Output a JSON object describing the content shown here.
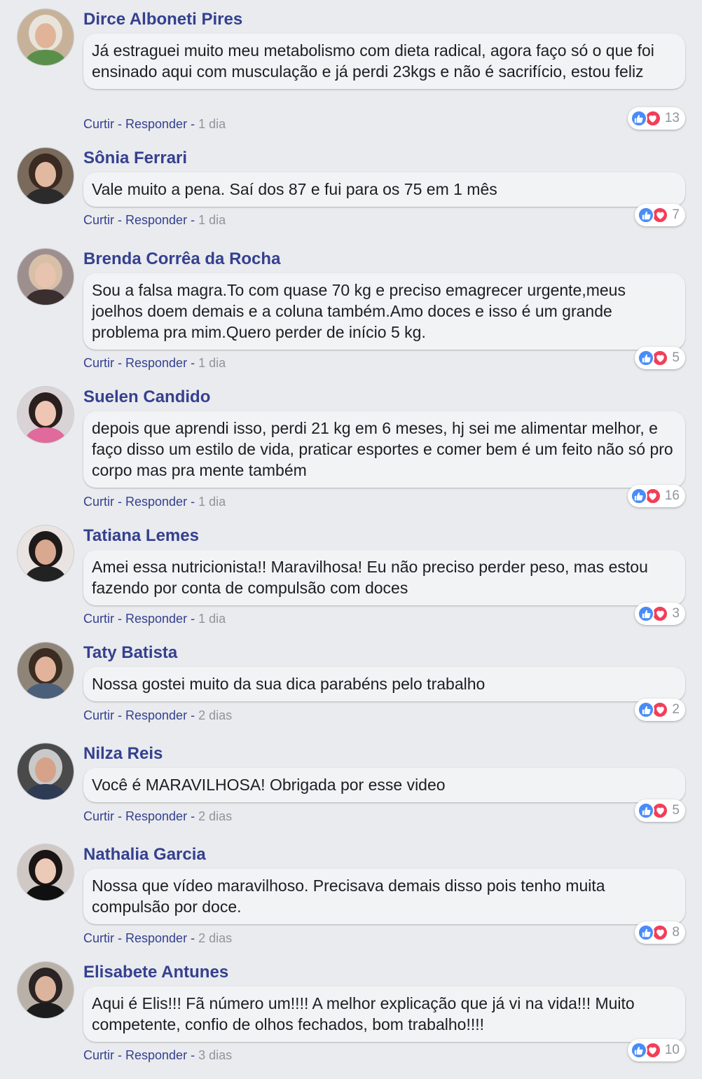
{
  "colors": {
    "background": "#e9ebee",
    "author_name": "#35408f",
    "bubble": "#f2f3f5",
    "timestamp": "#90949c",
    "like": "#4a8cf7",
    "love": "#f33e58"
  },
  "actions": {
    "like_label": "Curtir",
    "separator": " - ",
    "reply_label": "Responder"
  },
  "icons": {
    "like": "thumbs-up-icon",
    "love": "heart-icon"
  },
  "comments": [
    {
      "author": "Dirce Alboneti Pires",
      "text": "Já estraguei muito meu metabolismo com dieta radical, agora faço só o que foi ensinado aqui com musculação e já perdi 23kgs e não é sacrifício, estou feliz",
      "time": "1 dia",
      "reactions": "13"
    },
    {
      "author": "Sônia Ferrari",
      "text": "Vale muito a pena. Saí dos 87 e fui para os 75 em 1 mês",
      "time": "1 dia",
      "reactions": "7"
    },
    {
      "author": "Brenda Corrêa da Rocha",
      "text": "Sou a falsa magra.To com quase 70 kg e preciso emagrecer urgente,meus joelhos doem demais e a coluna também.Amo doces e isso é um grande problema pra mim.Quero perder de início 5 kg.",
      "time": "1 dia",
      "reactions": "5"
    },
    {
      "author": "Suelen Candido",
      "text": "depois que aprendi isso, perdi 21 kg em 6 meses, hj sei me alimentar melhor, e faço disso um estilo de vida, praticar esportes e comer bem é um feito não só pro corpo mas pra mente também",
      "time": "1 dia",
      "reactions": "16"
    },
    {
      "author": "Tatiana Lemes",
      "text": "Amei essa nutricionista!! Maravilhosa! Eu não preciso perder peso, mas estou fazendo por conta de compulsão com doces",
      "time": "1 dia",
      "reactions": "3"
    },
    {
      "author": "Taty Batista",
      "text": "Nossa gostei muito da sua dica parabéns pelo trabalho",
      "time": "2 dias",
      "reactions": "2"
    },
    {
      "author": "Nilza Reis",
      "text": "Você é MARAVILHOSA! Obrigada por esse video",
      "time": "2 dias",
      "reactions": "5"
    },
    {
      "author": "Nathalia Garcia",
      "text": "Nossa que vídeo maravilhoso. Precisava demais disso pois tenho muita compulsão por doce.",
      "time": "2 dias",
      "reactions": "8"
    },
    {
      "author": "Elisabete Antunes",
      "text": "Aqui é Elis!!! Fã número um!!!! A melhor explicação que já vi na vida!!! Muito competente, confio de olhos fechados, bom trabalho!!!!",
      "time": "3 dias",
      "reactions": "10"
    }
  ]
}
